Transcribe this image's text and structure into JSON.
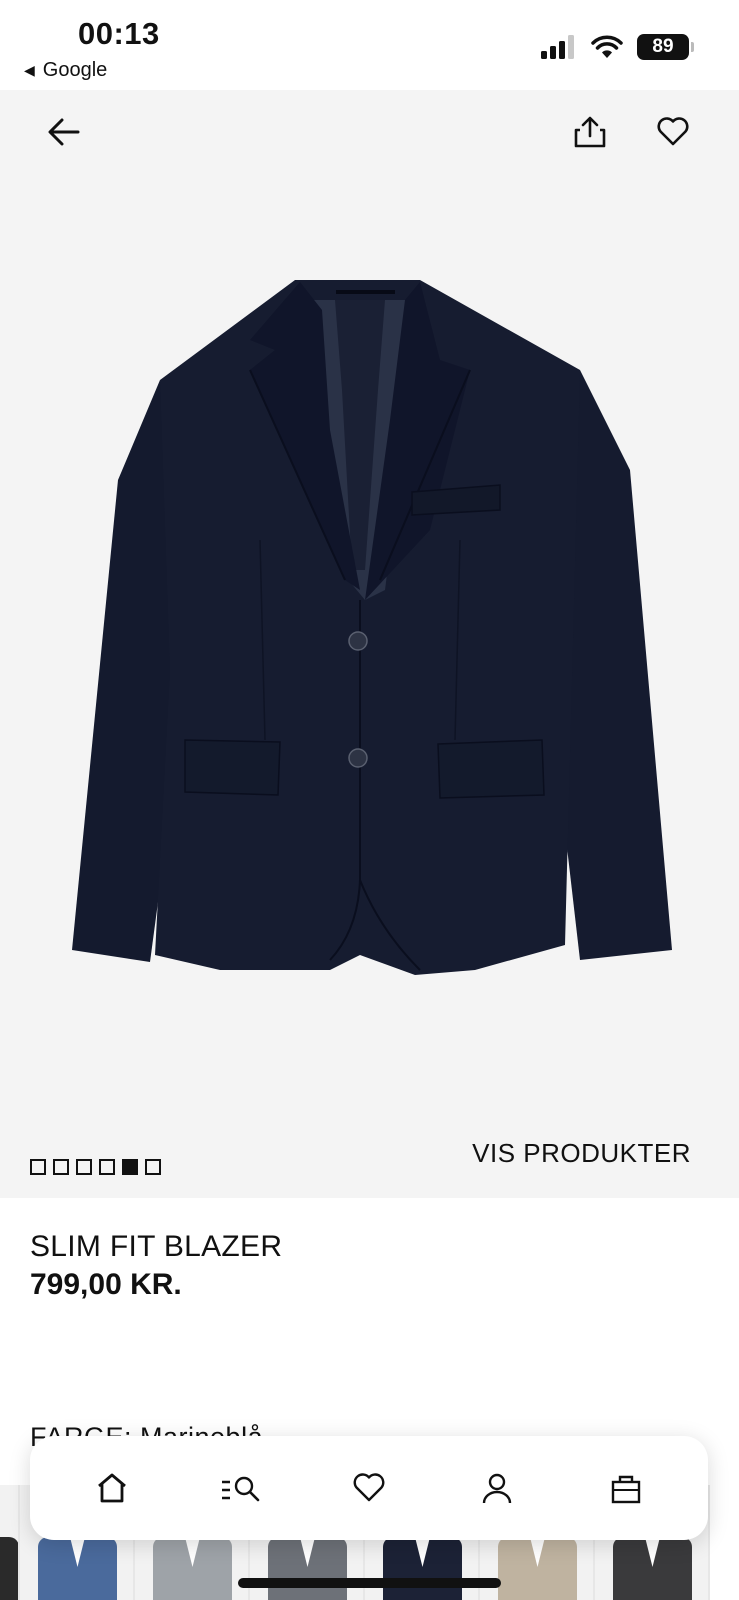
{
  "status_bar": {
    "time": "00:13",
    "back_app": "Google",
    "battery": "89",
    "icons": [
      "signal-icon",
      "wifi-icon",
      "battery-icon"
    ]
  },
  "nav": {
    "icons": [
      "arrow-left-icon",
      "share-icon",
      "heart-icon"
    ]
  },
  "gallery": {
    "image_count": 6,
    "active_index": 4,
    "vis_produkter": "VIS PRODUKTER"
  },
  "product": {
    "title": "SLIM FIT BLAZER",
    "price": "799,00 KR.",
    "color_label": "FARGE: Marineblå"
  },
  "swatches": [
    {
      "color": "#2a2a2a"
    },
    {
      "color": "#4a6a9c"
    },
    {
      "color": "#9ea3a8"
    },
    {
      "color": "#6d7178"
    },
    {
      "color": "#1c2236"
    },
    {
      "color": "#bfb3a0"
    },
    {
      "color": "#3a3a3c"
    }
  ],
  "tab_bar": {
    "items": [
      "home-icon",
      "search-icon",
      "heart-icon",
      "account-icon",
      "bag-icon"
    ]
  },
  "colors": {
    "jacket": "#141a2e",
    "background": "#f4f4f4",
    "text": "#111111"
  }
}
